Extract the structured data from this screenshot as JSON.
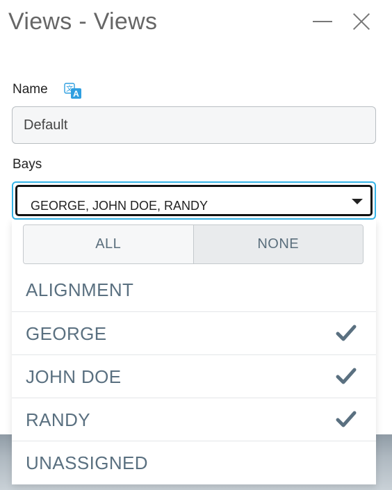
{
  "window": {
    "title": "Views - Views"
  },
  "form": {
    "name_label": "Name",
    "name_value": "Default",
    "bays_label": "Bays",
    "bays_selected": "GEORGE, JOHN DOE, RANDY"
  },
  "dropdown": {
    "all_label": "ALL",
    "none_label": "NONE",
    "options": [
      {
        "label": "ALIGNMENT",
        "checked": false
      },
      {
        "label": "GEORGE",
        "checked": true
      },
      {
        "label": "JOHN DOE",
        "checked": true
      },
      {
        "label": "RANDY",
        "checked": true
      },
      {
        "label": "UNASSIGNED",
        "checked": false
      }
    ]
  },
  "icons": {
    "translate": "translate-icon",
    "check": "check-icon",
    "minimize": "minimize-icon",
    "close": "close-icon",
    "caret": "caret-down-icon"
  },
  "colors": {
    "accent_focus": "#35b3e6",
    "option_text": "#5a7080",
    "check": "#5a7080"
  }
}
